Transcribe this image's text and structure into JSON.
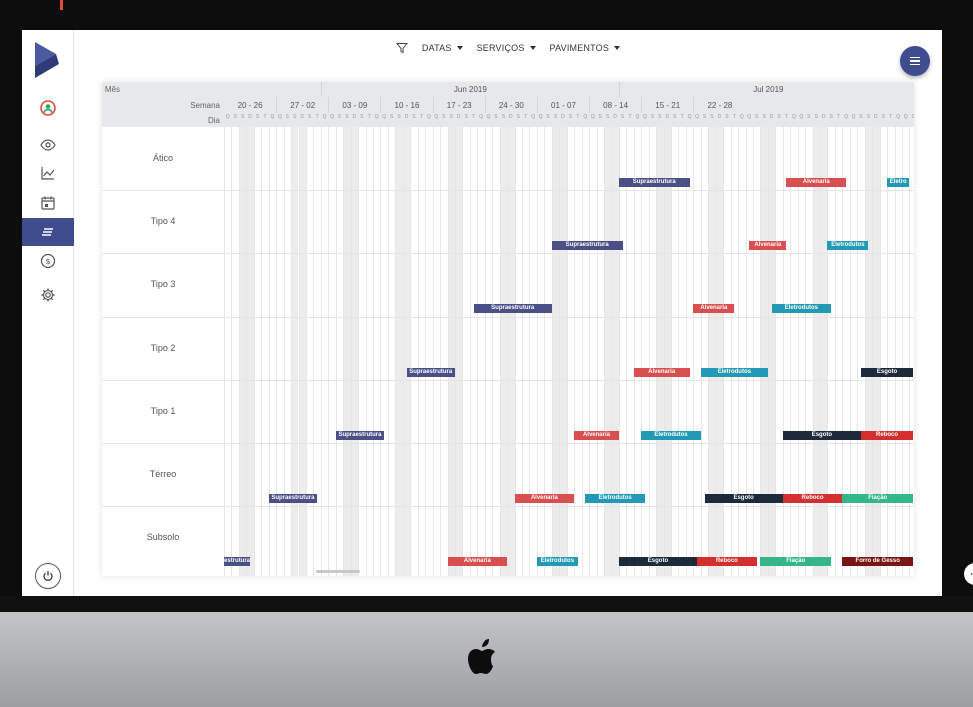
{
  "filters": {
    "datas": "DATAS",
    "servicos": "SERVIÇOS",
    "pavimentos": "PAVIMENTOS"
  },
  "header": {
    "mes_label": "Mês",
    "semana_label": "Semana",
    "dia_label": "Dia",
    "months": [
      "Jun 2019",
      "Jul 2019"
    ],
    "weeks": [
      "20 - 26",
      "27 - 02",
      "03 - 09",
      "10 - 16",
      "17 - 23",
      "24 - 30",
      "01 - 07",
      "08 - 14",
      "15 - 21",
      "22 - 28"
    ],
    "day_letters": [
      "D",
      "S",
      "T",
      "Q",
      "Q",
      "S",
      "S"
    ]
  },
  "rows": [
    "Ático",
    "Tipo 4",
    "Tipo 3",
    "Tipo 2",
    "Tipo 1",
    "Térreo",
    "Subsolo"
  ],
  "bars": [
    {
      "row": 0,
      "start": 53,
      "len": 9.5,
      "label": "Supraestrutura",
      "color": "#4a4f86"
    },
    {
      "row": 0,
      "start": 75.5,
      "len": 8,
      "label": "Alvenaria",
      "color": "#d94f4f"
    },
    {
      "row": 0,
      "start": 89,
      "len": 3,
      "label": "Eletro",
      "color": "#2299b5"
    },
    {
      "row": 1,
      "start": 44,
      "len": 9.5,
      "label": "Supraestrutura",
      "color": "#4a4f86"
    },
    {
      "row": 1,
      "start": 70.5,
      "len": 5,
      "label": "Alvenaria",
      "color": "#d94f4f"
    },
    {
      "row": 1,
      "start": 81,
      "len": 5.5,
      "label": "Eletrodutos",
      "color": "#2299b5"
    },
    {
      "row": 2,
      "start": 33.5,
      "len": 10.5,
      "label": "Supraestrutura",
      "color": "#4a4f86"
    },
    {
      "row": 2,
      "start": 63,
      "len": 5.5,
      "label": "Alvenaria",
      "color": "#d94f4f"
    },
    {
      "row": 2,
      "start": 73.5,
      "len": 8,
      "label": "Eletrodutos",
      "color": "#2299b5"
    },
    {
      "row": 3,
      "start": 24.5,
      "len": 6.5,
      "label": "Supraestrutura",
      "color": "#4a4f86"
    },
    {
      "row": 3,
      "start": 55,
      "len": 7.5,
      "label": "Alvenaria",
      "color": "#d94f4f"
    },
    {
      "row": 3,
      "start": 64,
      "len": 9,
      "label": "Eletrodutos",
      "color": "#2299b5"
    },
    {
      "row": 3,
      "start": 85.5,
      "len": 7,
      "label": "Esgoto",
      "color": "#1c2a3a"
    },
    {
      "row": 4,
      "start": 15,
      "len": 6.5,
      "label": "Supraestrutura",
      "color": "#4a4f86"
    },
    {
      "row": 4,
      "start": 47,
      "len": 6,
      "label": "Alvenaria",
      "color": "#d94f4f"
    },
    {
      "row": 4,
      "start": 56,
      "len": 8,
      "label": "Eletrodutos",
      "color": "#2299b5"
    },
    {
      "row": 4,
      "start": 75,
      "len": 10.5,
      "label": "Esgoto",
      "color": "#1c2a3a"
    },
    {
      "row": 4,
      "start": 85.5,
      "len": 7,
      "label": "Reboco",
      "color": "#d42f2f"
    },
    {
      "row": 5,
      "start": 6,
      "len": 6.5,
      "label": "Supraestrutura",
      "color": "#4a4f86"
    },
    {
      "row": 5,
      "start": 39,
      "len": 8,
      "label": "Alvenaria",
      "color": "#d94f4f"
    },
    {
      "row": 5,
      "start": 48.5,
      "len": 8,
      "label": "Eletrodutos",
      "color": "#2299b5"
    },
    {
      "row": 5,
      "start": 64.5,
      "len": 10.5,
      "label": "Esgoto",
      "color": "#1c2a3a"
    },
    {
      "row": 5,
      "start": 75,
      "len": 8,
      "label": "Reboco",
      "color": "#d42f2f"
    },
    {
      "row": 5,
      "start": 83,
      "len": 9.5,
      "label": "Fiação",
      "color": "#35b58a"
    },
    {
      "row": 6,
      "start": -0.5,
      "len": 4,
      "label": "estrutura",
      "color": "#4a4f86"
    },
    {
      "row": 6,
      "start": 30,
      "len": 8,
      "label": "Alvenaria",
      "color": "#d94f4f"
    },
    {
      "row": 6,
      "start": 42,
      "len": 5.5,
      "label": "Eletrodutos",
      "color": "#2299b5"
    },
    {
      "row": 6,
      "start": 53,
      "len": 10.5,
      "label": "Esgoto",
      "color": "#1c2a3a"
    },
    {
      "row": 6,
      "start": 63.5,
      "len": 8,
      "label": "Reboco",
      "color": "#d42f2f"
    },
    {
      "row": 6,
      "start": 72,
      "len": 9.5,
      "label": "Fiação",
      "color": "#35b58a"
    },
    {
      "row": 6,
      "start": 83,
      "len": 9.5,
      "label": "Forro de Gesso",
      "color": "#7a1515"
    }
  ],
  "sidebar": {
    "items": [
      "user-icon",
      "eye-icon",
      "chart-icon",
      "calendar-icon",
      "list-icon",
      "dollar-icon",
      "settings-icon"
    ],
    "active_index": 4
  }
}
